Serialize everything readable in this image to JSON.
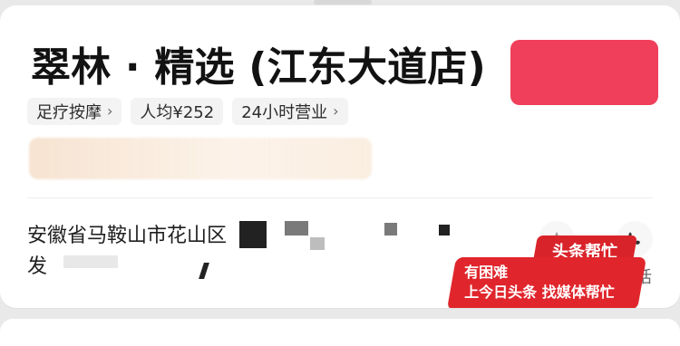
{
  "store": {
    "title": "翠林 · 精选 (江东大道店)"
  },
  "tags": [
    {
      "label": "足疗按摩"
    },
    {
      "label": "人均¥252"
    },
    {
      "label": "24小时营业"
    }
  ],
  "address": {
    "line1": "安徽省马鞍山市花山区",
    "line2": "发"
  },
  "contact": {
    "call_label": "话"
  },
  "badge": {
    "top": "头条帮忙",
    "line1": "有困难",
    "line2": "上今日头条 找媒体帮忙"
  }
}
